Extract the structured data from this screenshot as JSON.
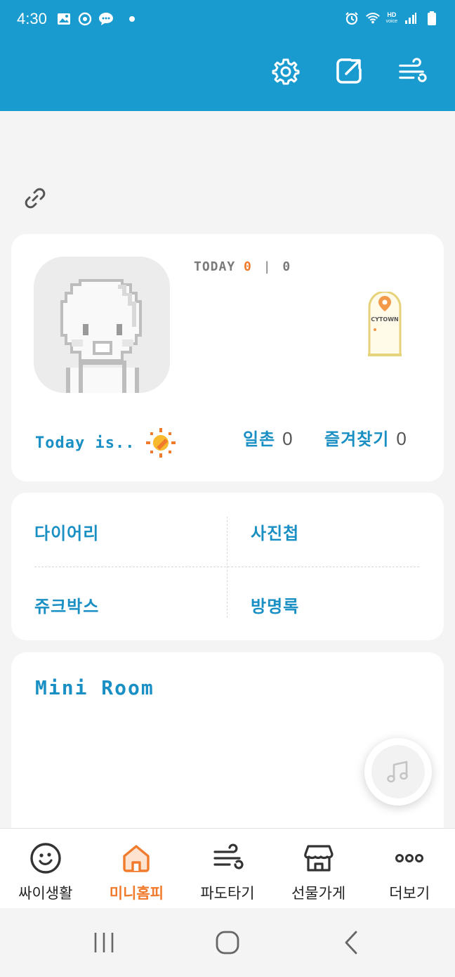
{
  "status_bar": {
    "time": "4:30",
    "hd_label": "HD",
    "voice_label": "voice"
  },
  "header": {
    "actions": [
      {
        "name": "settings-icon"
      },
      {
        "name": "share-icon"
      },
      {
        "name": "wind-menu-icon"
      }
    ],
    "color": "#1a9bcf"
  },
  "profile": {
    "today_label": "TODAY",
    "today_count": "0",
    "total_count": "0",
    "cytown_label": "CYTOWN",
    "today_is_label": "Today is..",
    "mood_icon": "sun-icon",
    "ilchon_label": "일촌",
    "ilchon_count": "0",
    "favorites_label": "즐겨찾기",
    "favorites_count": "0"
  },
  "menu": {
    "diary": "다이어리",
    "album": "사진첩",
    "jukebox": "쥬크박스",
    "guestbook": "방명록"
  },
  "miniroom": {
    "title": "Mini Room",
    "music_icon": "music-note-icon"
  },
  "bottom_nav": {
    "items": [
      {
        "label": "싸이생활",
        "icon": "smile-icon",
        "active": false
      },
      {
        "label": "미니홈피",
        "icon": "home-icon",
        "active": true
      },
      {
        "label": "파도타기",
        "icon": "wind-icon",
        "active": false
      },
      {
        "label": "선물가게",
        "icon": "store-icon",
        "active": false
      },
      {
        "label": "더보기",
        "icon": "more-icon",
        "active": false
      }
    ]
  },
  "colors": {
    "accent": "#1a9bcf",
    "active": "#f07b2c",
    "text_blue": "#1a8fc4"
  }
}
